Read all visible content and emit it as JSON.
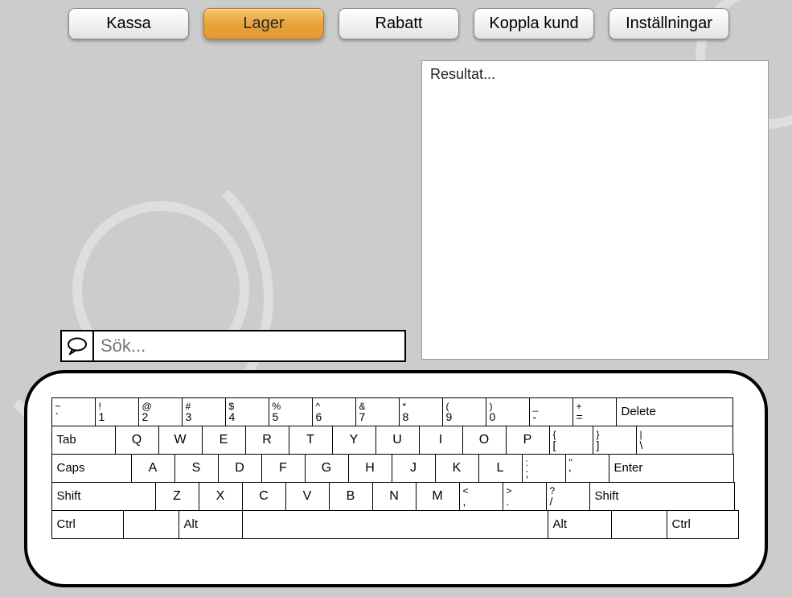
{
  "nav": {
    "kassa": "Kassa",
    "lager": "Lager",
    "rabatt": "Rabatt",
    "koppla": "Koppla kund",
    "installningar": "Inställningar",
    "active": "lager"
  },
  "results": {
    "placeholder": "Resultat..."
  },
  "search": {
    "placeholder": "Sök..."
  },
  "keyboard": {
    "row1": [
      {
        "top": "~",
        "bot": "`"
      },
      {
        "top": "!",
        "bot": "1"
      },
      {
        "top": "@",
        "bot": "2"
      },
      {
        "top": "#",
        "bot": "3"
      },
      {
        "top": "$",
        "bot": "4"
      },
      {
        "top": "%",
        "bot": "5"
      },
      {
        "top": "^",
        "bot": "6"
      },
      {
        "top": "&",
        "bot": "7"
      },
      {
        "top": "*",
        "bot": "8"
      },
      {
        "top": "(",
        "bot": "9"
      },
      {
        "top": ")",
        "bot": "0"
      },
      {
        "top": "_",
        "bot": "-"
      },
      {
        "top": "+",
        "bot": "="
      }
    ],
    "row1_end": "Delete",
    "row2_start": "Tab",
    "row2": [
      "Q",
      "W",
      "E",
      "R",
      "T",
      "Y",
      "U",
      "I",
      "O",
      "P"
    ],
    "row2_end": [
      {
        "top": "{",
        "bot": "["
      },
      {
        "top": "}",
        "bot": "]"
      },
      {
        "top": "|",
        "bot": "\\"
      }
    ],
    "row3_start": "Caps",
    "row3": [
      "A",
      "S",
      "D",
      "F",
      "G",
      "H",
      "J",
      "K",
      "L"
    ],
    "row3_punct": [
      {
        "top": ":",
        "bot": ";"
      },
      {
        "top": "\"",
        "bot": "'"
      }
    ],
    "row3_end": "Enter",
    "row4_start": "Shift",
    "row4": [
      "Z",
      "X",
      "C",
      "V",
      "B",
      "N",
      "M"
    ],
    "row4_punct": [
      {
        "top": "<",
        "bot": ","
      },
      {
        "top": ">",
        "bot": "."
      },
      {
        "top": "?",
        "bot": "/"
      }
    ],
    "row4_end": "Shift",
    "row5": {
      "ctrl": "Ctrl",
      "alt": "Alt",
      "space": "",
      "alt2": "Alt",
      "ctrl2": "Ctrl"
    }
  }
}
